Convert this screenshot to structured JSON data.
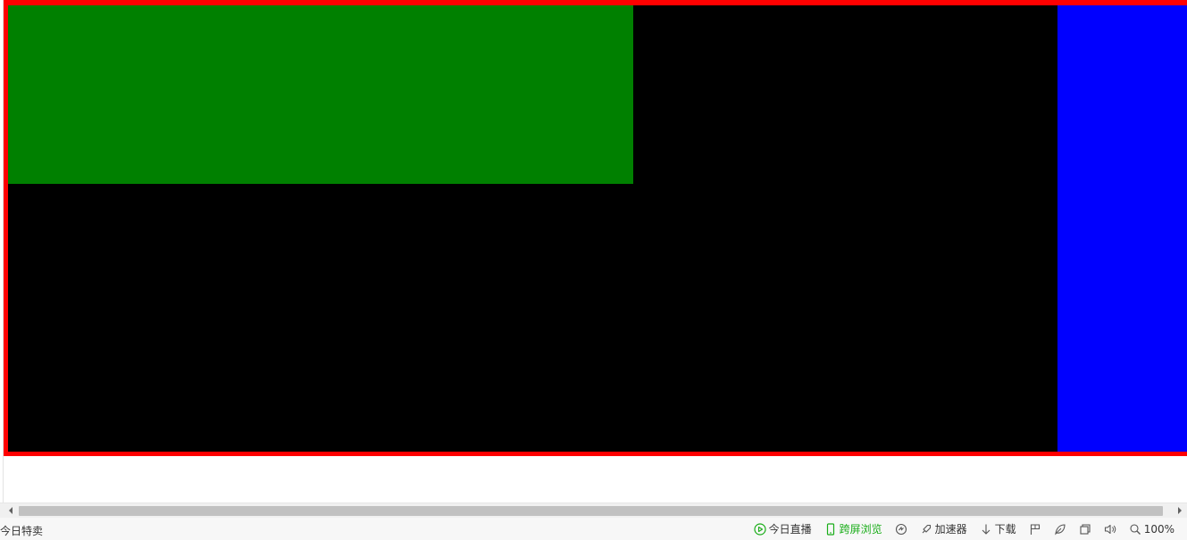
{
  "page": {
    "colors": {
      "frame": "#ff0000",
      "background_block": "#000000",
      "green_block": "#008000",
      "blue_block": "#0000ff"
    }
  },
  "statusbar": {
    "left_text": "今日特卖",
    "live_label": "今日直播",
    "cross_screen_label": "跨屏浏览",
    "accelerator_label": "加速器",
    "download_label": "下载",
    "zoom_label": "100%",
    "accent_color": "#1aad19",
    "icons": [
      "play-circle-icon",
      "phone-icon",
      "speed-icon",
      "rocket-icon",
      "download-arrow-icon",
      "flag-icon",
      "leaf-icon",
      "window-icon",
      "speaker-icon",
      "zoom-icon"
    ]
  }
}
